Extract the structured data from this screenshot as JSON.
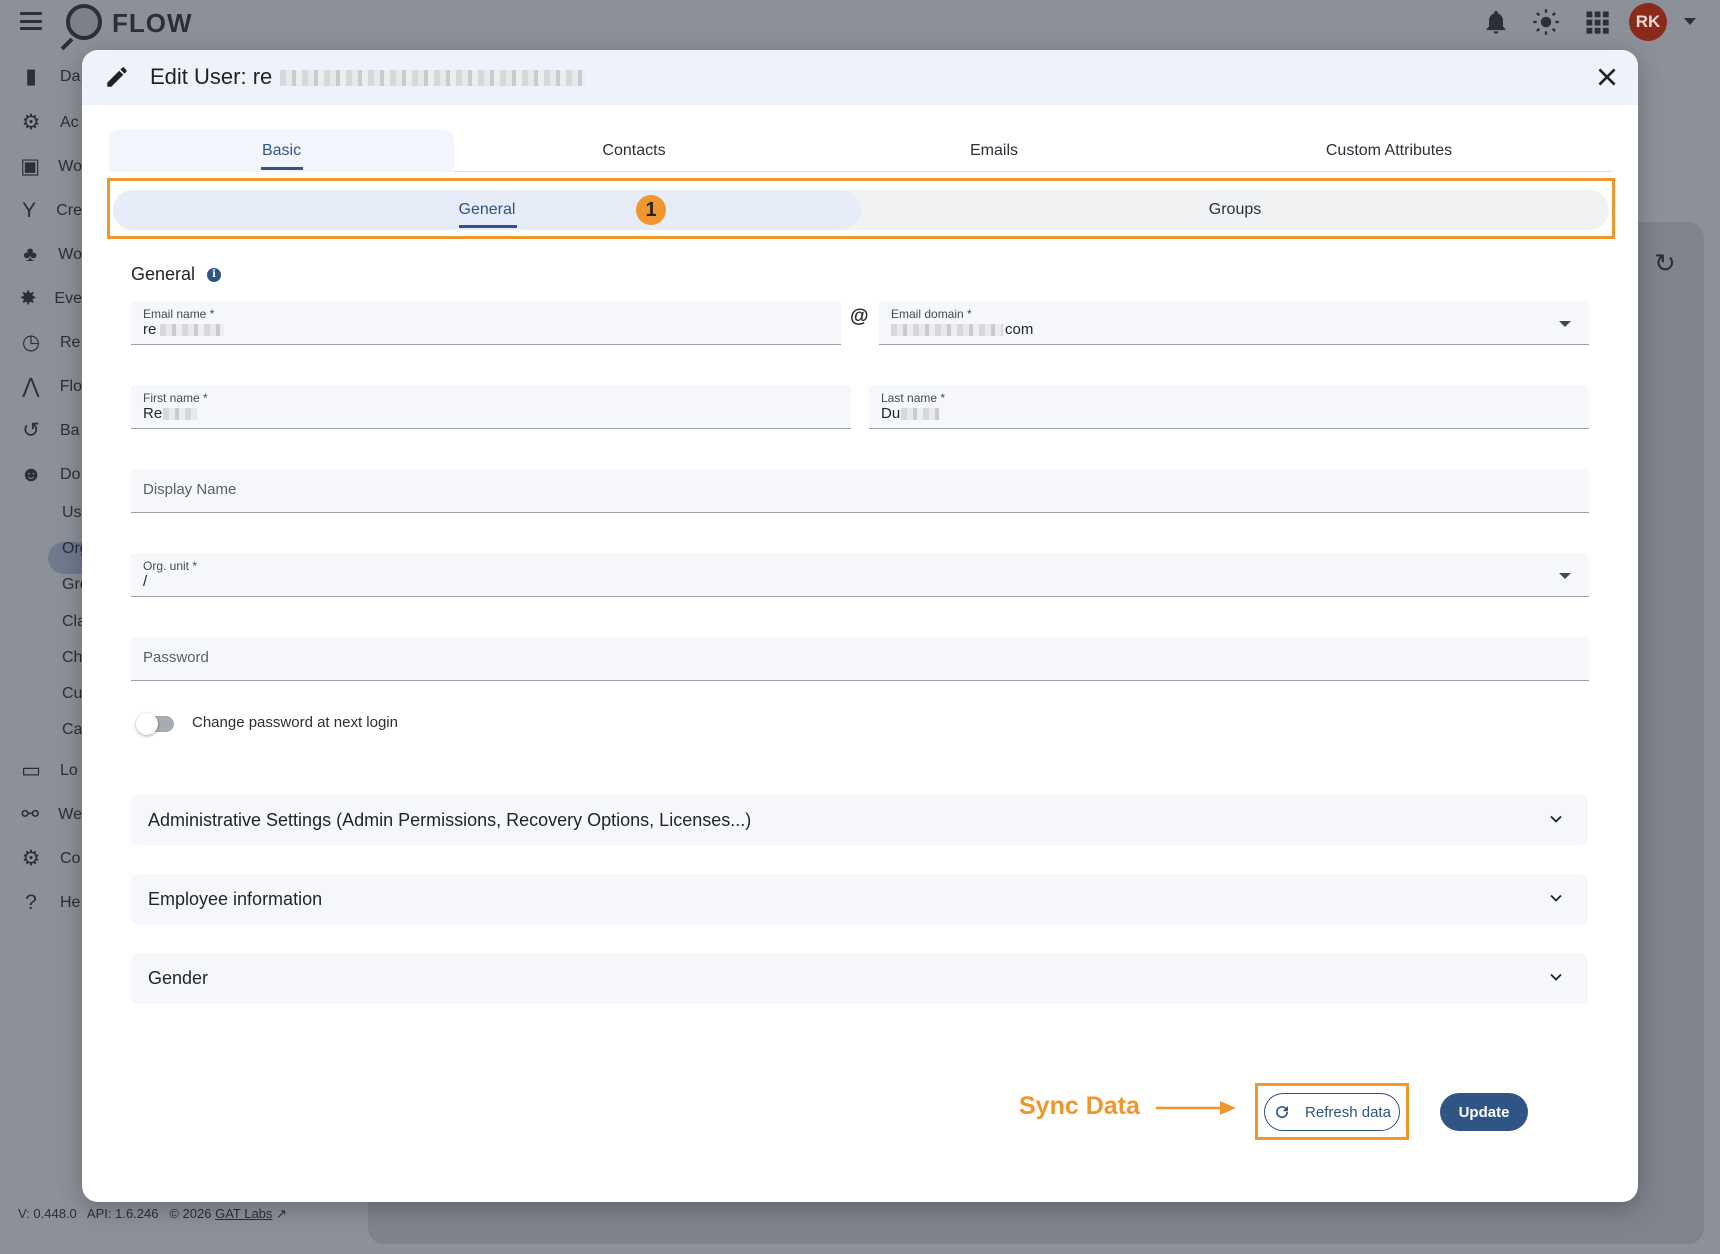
{
  "app": {
    "name": "FLOW",
    "avatar_initials": "RK"
  },
  "topbar_icons": [
    "bell-icon",
    "sun-icon",
    "apps-grid-icon"
  ],
  "sidebar": {
    "items": [
      {
        "label": "Da",
        "icon": "bar-chart-icon"
      },
      {
        "label": "Ac",
        "icon": "gears-icon"
      },
      {
        "label": "Wo",
        "icon": "window-code-icon"
      },
      {
        "label": "Cre",
        "icon": "fork-icon"
      },
      {
        "label": "Wo",
        "icon": "hierarchy-icon"
      },
      {
        "label": "Eve",
        "icon": "alarm-icon"
      },
      {
        "label": "Re",
        "icon": "clock-icon"
      },
      {
        "label": "Flo",
        "icon": "flow-icon"
      },
      {
        "label": "Ba",
        "icon": "history-icon"
      },
      {
        "label": "Do",
        "icon": "people-icon"
      },
      {
        "label": "Lo",
        "icon": "log-icon"
      },
      {
        "label": "We",
        "icon": "webhook-icon"
      },
      {
        "label": "Co",
        "icon": "gear-icon"
      },
      {
        "label": "He",
        "icon": "help-icon"
      }
    ],
    "sub_items": [
      "Us",
      "Org",
      "Gro",
      "Cla",
      "Ch",
      "Cu",
      "Ca"
    ]
  },
  "footer": {
    "version": "V: 0.448.0",
    "api": "API: 1.6.246",
    "copyright": "© 2026",
    "company": "GAT Labs"
  },
  "modal": {
    "title": "Edit User: re",
    "tabs": [
      {
        "label": "Basic",
        "active": true
      },
      {
        "label": "Contacts",
        "active": false
      },
      {
        "label": "Emails",
        "active": false
      },
      {
        "label": "Custom Attributes",
        "active": false
      }
    ],
    "subtabs": [
      {
        "label": "General",
        "active": true
      },
      {
        "label": "Groups",
        "active": false
      }
    ],
    "annotation_number": "1",
    "section_title": "General",
    "fields": {
      "email_name": {
        "label": "Email name *",
        "value": "re"
      },
      "at": "@",
      "email_domain": {
        "label": "Email domain *",
        "value": "com"
      },
      "first_name": {
        "label": "First name *",
        "value": "Re"
      },
      "last_name": {
        "label": "Last name *",
        "value": "Du"
      },
      "display_name": {
        "placeholder": "Display Name"
      },
      "org_unit": {
        "label": "Org. unit *",
        "value": "/"
      },
      "password": {
        "placeholder": "Password"
      }
    },
    "toggle": {
      "label": "Change password at next login",
      "checked": false
    },
    "accordions": [
      "Administrative Settings (Admin Permissions, Recovery Options, Licenses...)",
      "Employee information",
      "Gender"
    ],
    "annotation_text": "Sync Data",
    "buttons": {
      "refresh": "Refresh data",
      "update": "Update"
    }
  },
  "colors": {
    "accent": "#2f5584",
    "highlight": "#f0962c"
  }
}
